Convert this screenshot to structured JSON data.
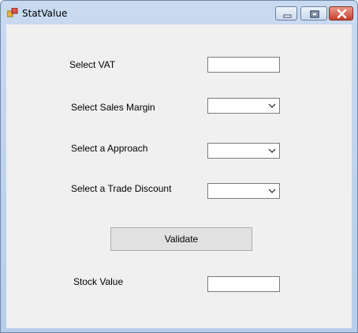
{
  "window": {
    "title": "StatValue"
  },
  "form": {
    "vat_label": "Select VAT",
    "vat_value": "",
    "sales_margin_label": "Select Sales Margin",
    "sales_margin_value": "",
    "approach_label": "Select a Approach",
    "approach_value": "",
    "trade_discount_label": "Select a Trade Discount",
    "trade_discount_value": "",
    "validate_label": "Validate",
    "stock_value_label": "Stock Value",
    "stock_value": ""
  },
  "icons": {
    "app": "app-icon",
    "minimize": "minimize-icon",
    "maximize": "maximize-icon",
    "close": "close-icon",
    "dropdown": "chevron-down-icon"
  }
}
